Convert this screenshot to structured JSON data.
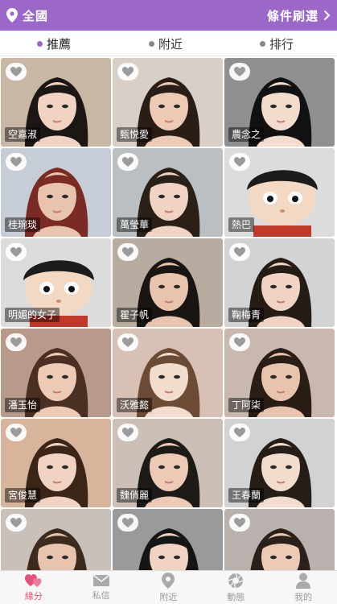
{
  "header": {
    "location_label": "全國",
    "filter_label": "條件刷選",
    "accent_color": "#9b68c9"
  },
  "tabs": [
    {
      "label": "推薦",
      "active": true
    },
    {
      "label": "附近",
      "active": false
    },
    {
      "label": "排行",
      "active": false
    }
  ],
  "profiles": [
    {
      "name": "空嘉淑"
    },
    {
      "name": "甄悦愛"
    },
    {
      "name": "農念之"
    },
    {
      "name": "桂琬琰"
    },
    {
      "name": "萬瑩華"
    },
    {
      "name": "熱巴"
    },
    {
      "name": "明媚的女子"
    },
    {
      "name": "瞿子帆"
    },
    {
      "name": "鞠梅青"
    },
    {
      "name": "潘玉怡"
    },
    {
      "name": "沃雅懿"
    },
    {
      "name": "丁阿柒"
    },
    {
      "name": "宮俊慧"
    },
    {
      "name": "魏俏麗"
    },
    {
      "name": "王春蘭"
    },
    {
      "name": ""
    },
    {
      "name": ""
    },
    {
      "name": ""
    }
  ],
  "bottom_nav": [
    {
      "label": "緣分",
      "icon": "hearts-icon",
      "active": true
    },
    {
      "label": "私信",
      "icon": "envelope-icon",
      "active": false
    },
    {
      "label": "附近",
      "icon": "location-pin-icon",
      "active": false
    },
    {
      "label": "動態",
      "icon": "camera-shutter-icon",
      "active": false
    },
    {
      "label": "我的",
      "icon": "person-icon",
      "active": false
    }
  ]
}
